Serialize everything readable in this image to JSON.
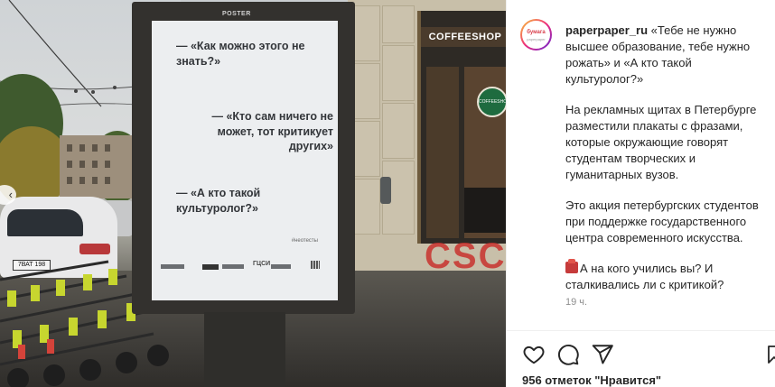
{
  "post": {
    "username": "paperpaper_ru",
    "avatar_logo_top": "бумага",
    "avatar_logo_bottom": "paperpaper",
    "caption_first": "«Тебе не нужно высшее образование, тебе нужно рожать» и «А кто такой культуролог?»",
    "caption_p2": "На рекламных щитах в Петербурге разместили плакаты с фразами, которые окружающие говорят студентам творческих и гуманитарных вузов.",
    "caption_p3": "Это акция петербургских студентов при поддержке государственного центра современного искусства.",
    "caption_p4": "А на кого учились вы? И сталкивались ли с критикой?",
    "caption_p4_emoji": "school-building-emoji",
    "time": "19 ч.",
    "likes": "956 отметок \"Нравится\""
  },
  "poster": {
    "stand_brand": "POSTER",
    "quote1": "— «Как можно этого не знать?»",
    "quote2": "— «Кто сам ничего не может, тот критикует других»",
    "quote3": "— «А кто такой культуролог?»",
    "hashtag": "#неотесты",
    "sponsor": "ГЦСИ"
  },
  "scene": {
    "shop_sign": "COFFEESHOP",
    "logo_text": "COFFEESHOP COMPANY",
    "neon_text": "CSC",
    "car_plate": "7ВАТ 198"
  },
  "icons": {
    "like": "heart-icon",
    "comment": "comment-bubble-icon",
    "share": "paper-plane-icon",
    "save": "bookmark-icon",
    "prev": "chevron-left-icon"
  },
  "colors": {
    "text": "#262626",
    "secondary": "#8e8e8e",
    "avatar_ring_start": "#f9ce34",
    "avatar_ring_end": "#6228d7"
  }
}
